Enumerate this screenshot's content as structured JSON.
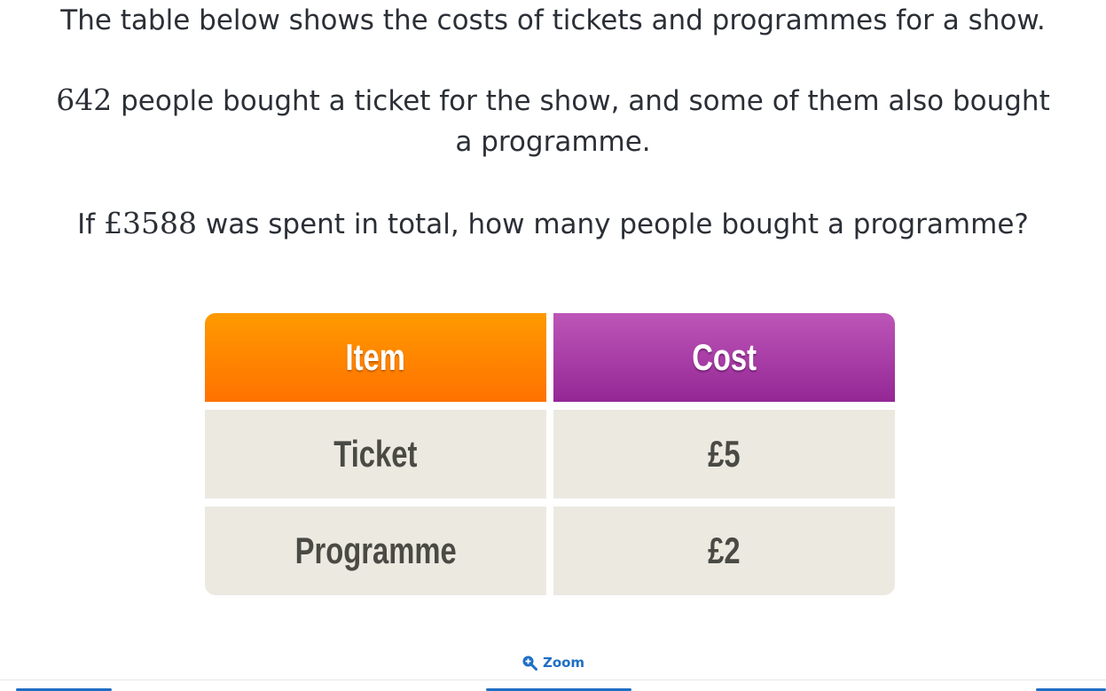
{
  "question": {
    "line1": "The table below shows the costs of tickets and programmes for a show.",
    "line2_math": "642",
    "line2_text": " people bought a ticket for the show, and some of them also bought",
    "line2b_text": "a programme.",
    "line3_prefix": "If ",
    "line3_math": "£3588",
    "line3_text": " was spent in total, how many people bought a programme?"
  },
  "table": {
    "headers": [
      "Item",
      "Cost"
    ],
    "rows": [
      [
        "Ticket",
        "£5"
      ],
      [
        "Programme",
        "£2"
      ]
    ],
    "colors": {
      "item_header": "#ff8200",
      "cost_header": "#a8369f",
      "body": "#ece9e1"
    }
  },
  "zoom": {
    "label": "Zoom",
    "icon": "zoom-in-icon"
  }
}
